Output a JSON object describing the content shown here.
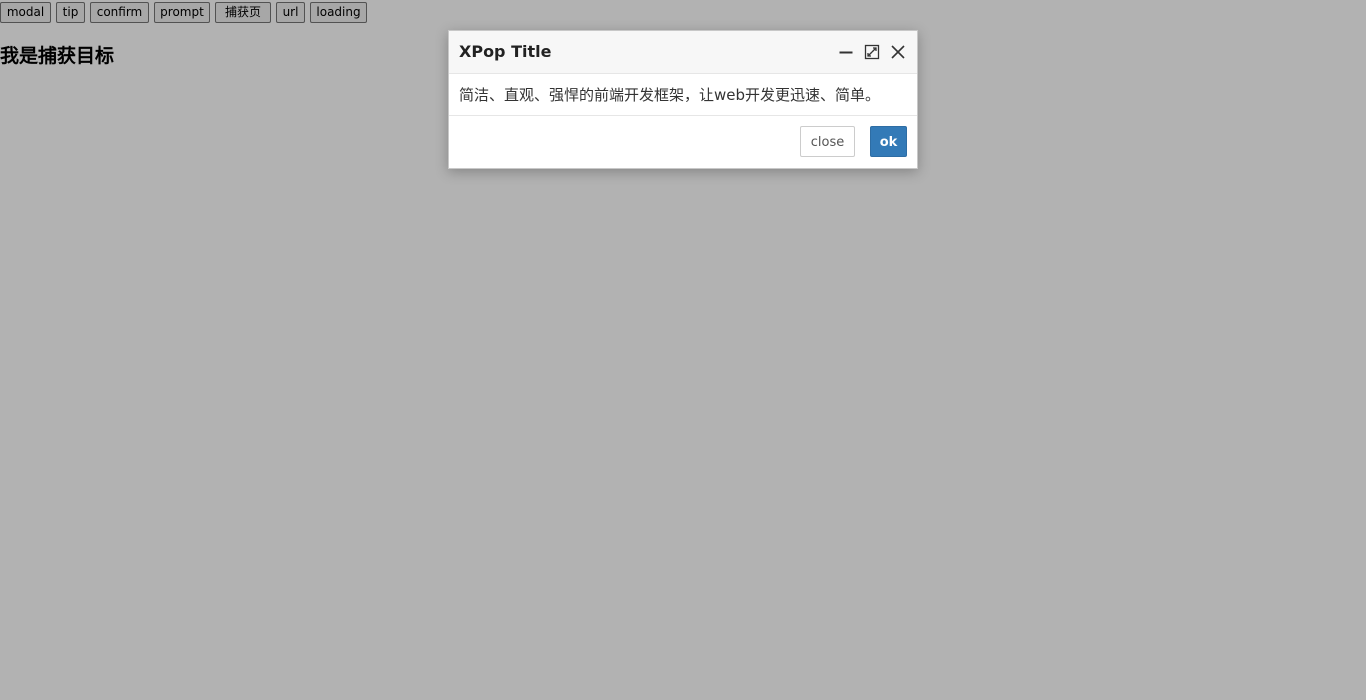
{
  "toolbar": {
    "buttons": [
      {
        "label": "modal"
      },
      {
        "label": "tip"
      },
      {
        "label": "confirm"
      },
      {
        "label": "prompt"
      },
      {
        "label": "捕获页"
      },
      {
        "label": "url"
      },
      {
        "label": "loading"
      }
    ]
  },
  "page": {
    "heading": "我是捕获目标"
  },
  "dialog": {
    "title": "XPop Title",
    "content": "简洁、直观、强悍的前端开发框架，让web开发更迅速、简单。",
    "close_label": "close",
    "ok_label": "ok",
    "icons": [
      "minimize-icon",
      "maximize-icon",
      "close-icon"
    ]
  },
  "colors": {
    "overlay": "#b3b3b3",
    "ok_button": "#337ab7",
    "header_bg": "#f7f7f7"
  }
}
